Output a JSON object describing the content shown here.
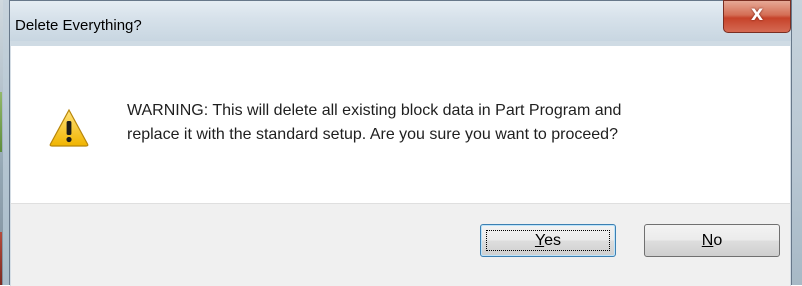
{
  "window": {
    "title": "Delete Everything?",
    "close_glyph": "X"
  },
  "message": {
    "line1": "WARNING: This will delete all existing block data in Part Program and",
    "line2": "replace it with the standard setup. Are you sure you want to proceed?",
    "icon": "warning-icon"
  },
  "buttons": {
    "yes": {
      "mnemonic": "Y",
      "rest": "es",
      "focused": true
    },
    "no": {
      "mnemonic": "N",
      "rest": "o",
      "focused": false
    }
  },
  "colors": {
    "warning_fill": "#f5c400",
    "close_button": "#c6432a",
    "focus_border": "#3c7fb1"
  }
}
